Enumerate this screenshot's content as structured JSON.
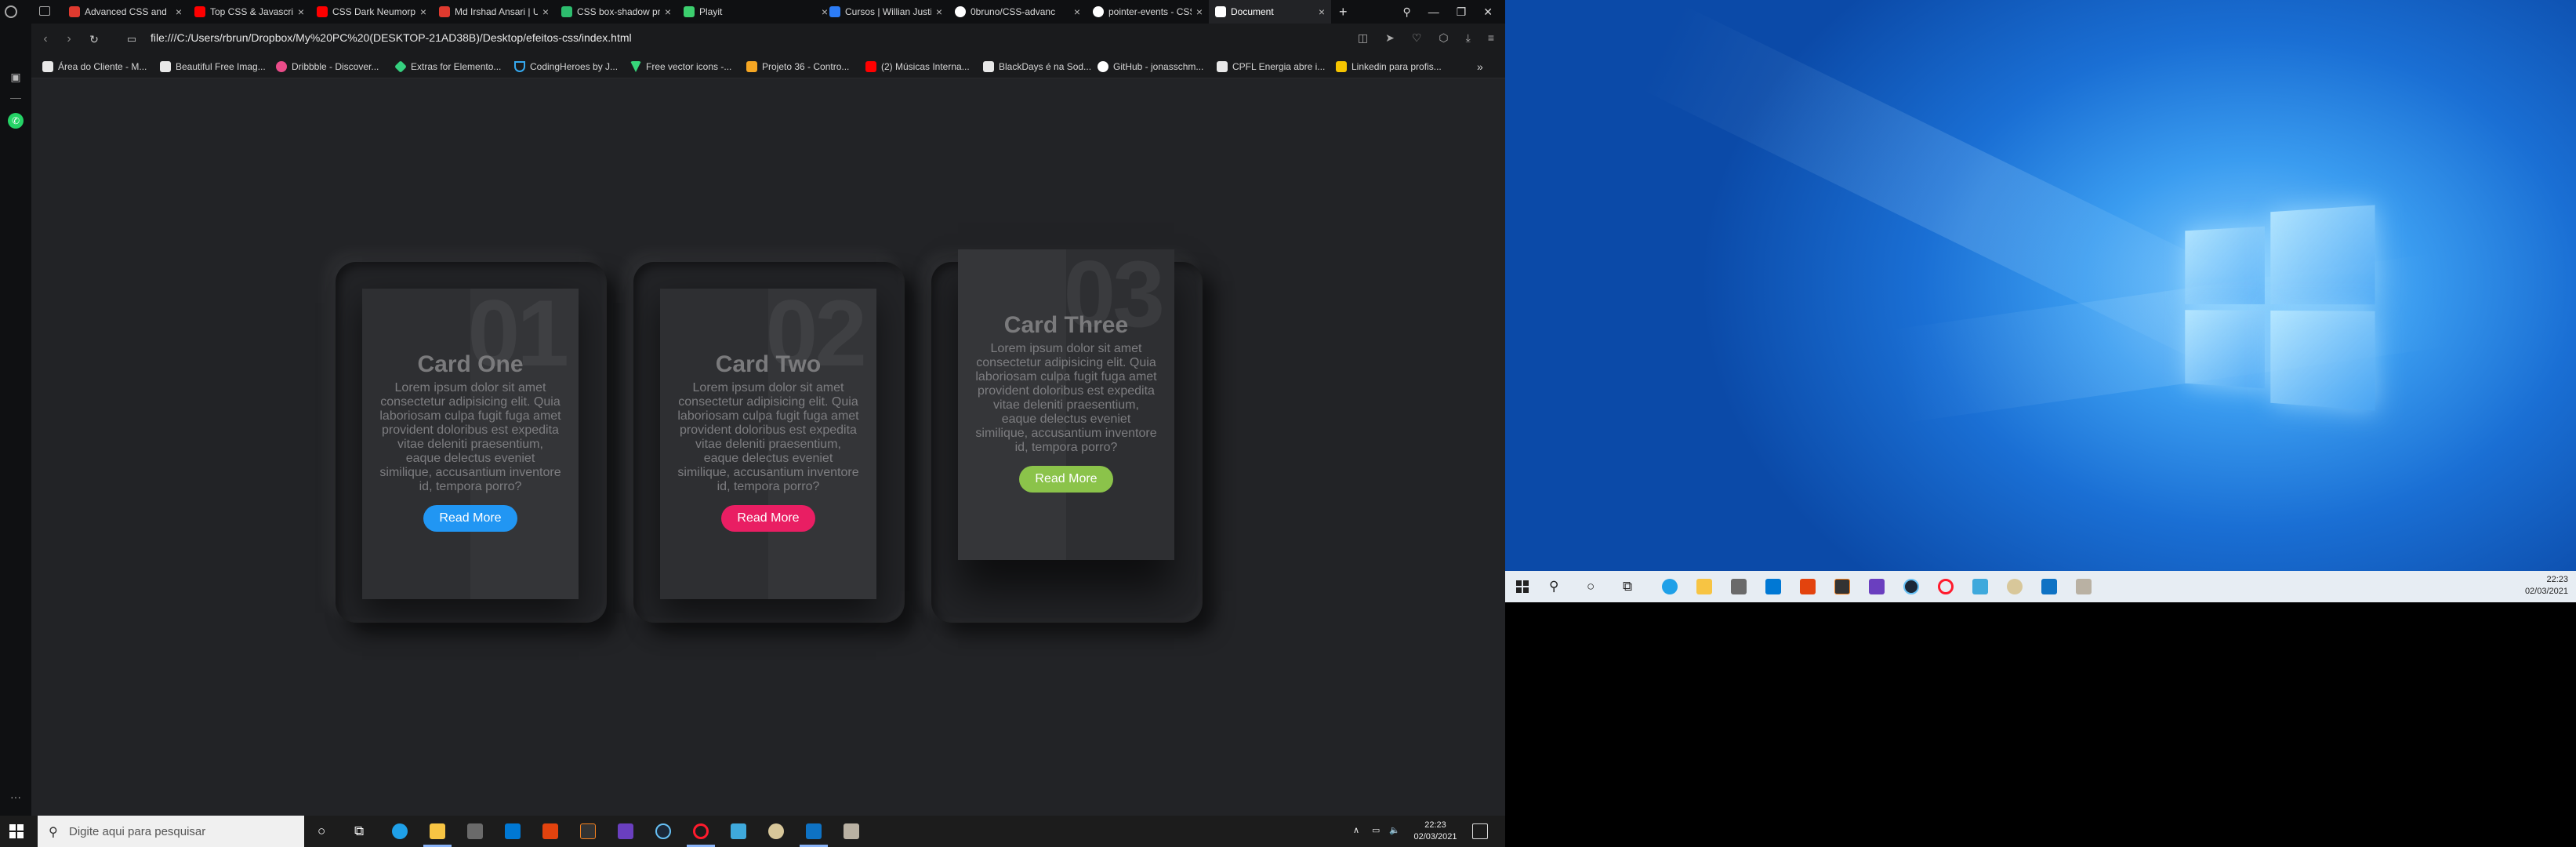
{
  "browser": {
    "tabs": [
      {
        "label": "Advanced CSS and",
        "color": "#e03a2f"
      },
      {
        "label": "Top CSS & Javascrip",
        "color": "#ff0000"
      },
      {
        "label": "CSS Dark Neumorph",
        "color": "#ff0000"
      },
      {
        "label": "Md Irshad Ansari | U",
        "color": "#e03a2f"
      },
      {
        "label": "CSS box-shadow pr",
        "color": "#2dbd6e"
      },
      {
        "label": "Playit",
        "color": "#3ccf6e"
      },
      {
        "label": "Cursos | Willian Justi",
        "color": "#2c7cf6"
      },
      {
        "label": "0bruno/CSS-advanc",
        "color": "#ffffff"
      },
      {
        "label": "pointer-events - CSS",
        "color": "#ffffff"
      },
      {
        "label": "Document",
        "color": "#ffffff"
      }
    ],
    "new_tab": "+",
    "url": "file:///C:/Users/rbrun/Dropbox/My%20PC%20(DESKTOP-21AD38B)/Desktop/efeitos-css/index.html",
    "bookmarks": [
      {
        "label": "Área do Cliente - M...",
        "color": "#e8e8e8"
      },
      {
        "label": "Beautiful Free Imag...",
        "color": "#e8e8e8"
      },
      {
        "label": "Dribbble - Discover...",
        "color": "#ea4c89"
      },
      {
        "label": "Extras for Elemento...",
        "color": "#35d07f"
      },
      {
        "label": "CodingHeroes by J...",
        "color": "#35a9f0"
      },
      {
        "label": "Free vector icons -...",
        "color": "#37d67a"
      },
      {
        "label": "Projeto 36 - Contro...",
        "color": "#f5a623"
      },
      {
        "label": "(2) Músicas Interna...",
        "color": "#ff0000"
      },
      {
        "label": "BlackDays é na Sod...",
        "color": "#e8e8e8"
      },
      {
        "label": "GitHub - jonasschm...",
        "color": "#ffffff"
      },
      {
        "label": "CPFL Energia abre i...",
        "color": "#e8e8e8"
      },
      {
        "label": "Linkedin para profis...",
        "color": "#f5c400"
      }
    ],
    "bookmarks_more": "»"
  },
  "cards": [
    {
      "number": "01",
      "title": "Card One",
      "body": "Lorem ipsum dolor sit amet consectetur adipisicing elit. Quia laboriosam culpa fugit fuga amet provident doloribus est expedita vitae deleniti praesentium, eaque delectus eveniet similique, accusantium inventore id, tempora porro?",
      "button": "Read More",
      "button_color": "#2196f3"
    },
    {
      "number": "02",
      "title": "Card Two",
      "body": "Lorem ipsum dolor sit amet consectetur adipisicing elit. Quia laboriosam culpa fugit fuga amet provident doloribus est expedita vitae deleniti praesentium, eaque delectus eveniet similique, accusantium inventore id, tempora porro?",
      "button": "Read More",
      "button_color": "#e91e63"
    },
    {
      "number": "03",
      "title": "Card Three",
      "body": "Lorem ipsum dolor sit amet consectetur adipisicing elit. Quia laboriosam culpa fugit fuga amet provident doloribus est expedita vitae deleniti praesentium, eaque delectus eveniet similique, accusantium inventore id, tempora porro?",
      "button": "Read More",
      "button_color": "#8bc34a"
    }
  ],
  "taskbar_left": {
    "search_placeholder": "Digite aqui para pesquisar",
    "time": "22:23",
    "date": "02/03/2021",
    "apps": [
      "cortana-icon",
      "task-view-icon",
      "edge-icon",
      "file-explorer-icon",
      "store-icon",
      "mail-icon",
      "office-icon",
      "steam-like-icon",
      "app-icon",
      "steam-icon",
      "opera-icon",
      "krita-icon",
      "app-icon-2",
      "vscode-icon",
      "app-icon-3"
    ]
  },
  "taskbar_right": {
    "time": "22:23",
    "date": "02/03/2021"
  }
}
